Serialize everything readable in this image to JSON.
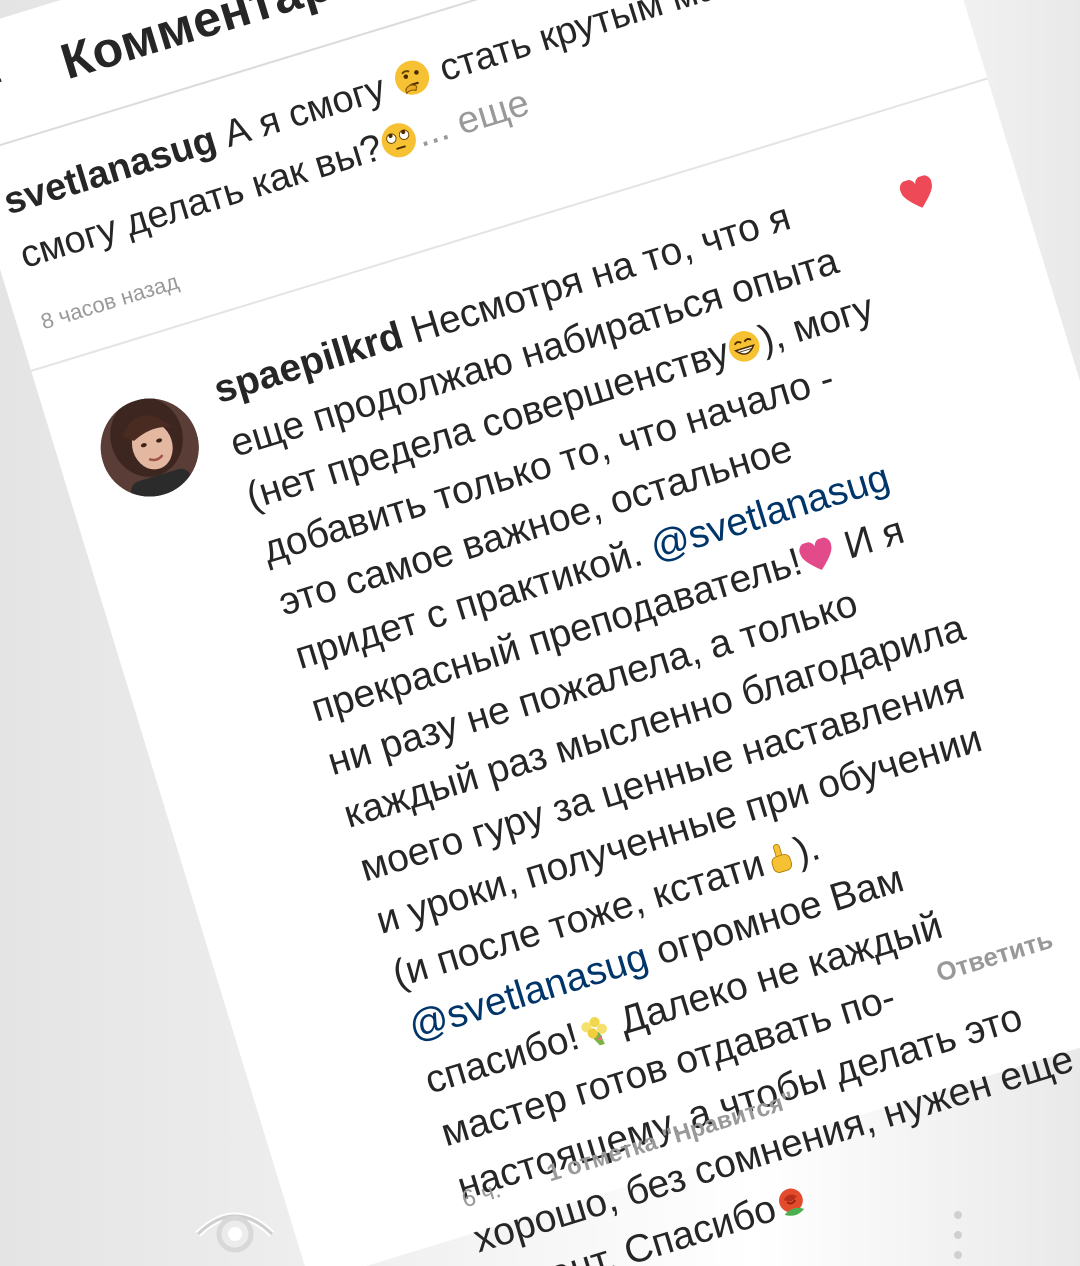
{
  "header": {
    "title": "Комментарии",
    "back_icon": "arrow-left-icon"
  },
  "caption": {
    "username": "svetlanasug",
    "text_before_emoji": " А я смогу ",
    "emoji_1": "thinking-face-emoji",
    "text_middle": " стать крутым мастером, смогу делать как вы?",
    "emoji_2": "face-with-rolling-eyes-emoji",
    "more_label": "... еще",
    "time": "8 часов назад"
  },
  "comment": {
    "username": "spaepilkrd",
    "part_1": " Несмотря на то, что я еще продолжаю набираться опыта (нет предела совершенству",
    "emoji_grin": "grinning-face-emoji",
    "part_2": "), могу добавить только то, что начало - это самое важное, остальное придет с практикой. ",
    "mention_1": "@svetlanasug",
    "part_3": " прекрасный преподаватель!",
    "emoji_heart": "pink-heart-emoji",
    "part_4": " И я ни разу не пожалела, а только каждый раз мысленно благодарила моего гуру за ценные наставления и уроки, полученные при обучении (и после тоже, кстати",
    "emoji_point": "index-pointing-up-emoji",
    "part_5": "). ",
    "mention_2": "@svetlanasug",
    "part_6": " огромное Вам спасибо!",
    "emoji_bouquet": "bouquet-emoji",
    "part_7": " Далеко не каждый мастер готов отдавать по-настоящему, а чтобы делать это хорошо, без сомнения, нужен еще и талант. Спасибо",
    "emoji_rose": "rose-emoji",
    "time": "6 ч.",
    "likes": "1 отметка \"Нравится\"",
    "reply_label": "Ответить",
    "like_icon": "heart-icon",
    "like_color": "#ed4956"
  },
  "nav": {
    "eye_icon": "eye-icon",
    "dots_icon": "more-vertical-icon"
  }
}
